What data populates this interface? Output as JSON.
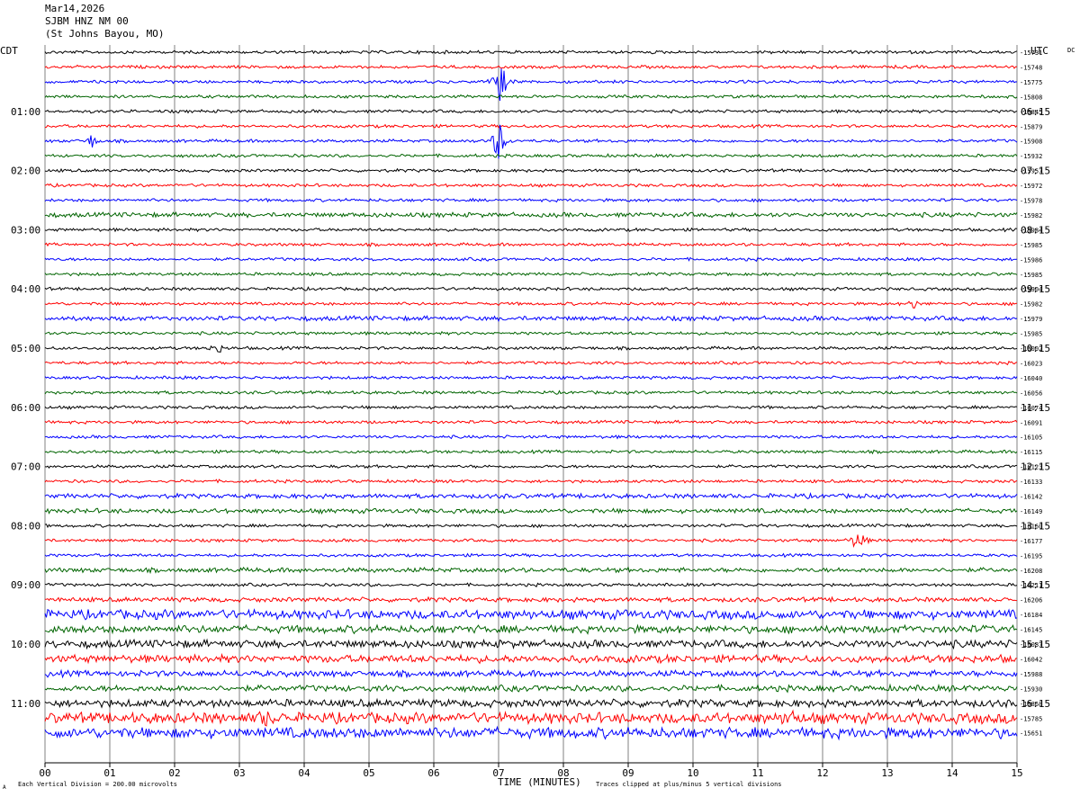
{
  "header": {
    "date": "Mar14,2026",
    "station": "SJBM HNZ NM 00",
    "location": "(St Johns Bayou, MO)"
  },
  "chart_data": {
    "type": "line",
    "title": "",
    "left_axis_label": "CDT",
    "right_axis_label": "UTC",
    "dc_label": "DC",
    "xlabel": "TIME (MINUTES)",
    "x_ticks": [
      "00",
      "01",
      "02",
      "03",
      "04",
      "05",
      "06",
      "07",
      "08",
      "09",
      "10",
      "11",
      "12",
      "13",
      "14",
      "15"
    ],
    "xlim": [
      0,
      15
    ],
    "left_hour_labels": [
      "01:00",
      "02:00",
      "03:00",
      "04:00",
      "05:00",
      "06:00",
      "07:00",
      "08:00",
      "09:00",
      "10:00",
      "11:00"
    ],
    "right_hour_labels": [
      "06:15",
      "07:15",
      "08:15",
      "09:15",
      "10:15",
      "11:15",
      "12:15",
      "13:15",
      "14:15",
      "15:15",
      "16:15"
    ],
    "trace_colors": [
      "#000000",
      "#ff0000",
      "#0000ff",
      "#006400"
    ],
    "dc_offsets": [
      "-15731",
      "-15748",
      "-15775",
      "-15808",
      "-15845",
      "-15879",
      "-15908",
      "-15932",
      "-15957",
      "-15972",
      "-15978",
      "-15982",
      "-15984",
      "-15985",
      "-15986",
      "-15985",
      "-15904",
      "-15982",
      "-15979",
      "-15985",
      "-16002",
      "-16023",
      "-16040",
      "-16056",
      "-16074",
      "-16091",
      "-16105",
      "-16115",
      "-16123",
      "-16133",
      "-16142",
      "-16149",
      "-16160",
      "-16177",
      "-16195",
      "-16208",
      "-16211",
      "-16206",
      "-16184",
      "-16145",
      "-16087",
      "-16042",
      "-15988",
      "-15930",
      "-15868",
      "-15785",
      "-15651"
    ],
    "noise_level": [
      2,
      2,
      2,
      2,
      2,
      2,
      2,
      2,
      2,
      2,
      2,
      3,
      2,
      2,
      2,
      2,
      2,
      2,
      3,
      2,
      2,
      2,
      2,
      2,
      2,
      2,
      2,
      2,
      2,
      2,
      3,
      3,
      2,
      2,
      2,
      3,
      2,
      3,
      6,
      5,
      5,
      5,
      4,
      4,
      5,
      7,
      7
    ],
    "events": [
      {
        "trace": 2,
        "minute": 7.03,
        "amplitude": 30
      },
      {
        "trace": 6,
        "minute": 7.0,
        "amplitude": 30
      },
      {
        "trace": 6,
        "minute": 0.72,
        "amplitude": 8
      },
      {
        "trace": 17,
        "minute": 13.4,
        "amplitude": 6
      },
      {
        "trace": 20,
        "minute": 2.65,
        "amplitude": 8
      },
      {
        "trace": 33,
        "minute": 12.55,
        "amplitude": 18
      },
      {
        "trace": 45,
        "minute": 3.4,
        "amplitude": 8
      },
      {
        "trace": 45,
        "minute": 11.5,
        "amplitude": 10
      }
    ],
    "footer_left": "Each Vertical Division =  200.00 microvolts",
    "footer_right": "Traces clipped at plus/minus 5 vertical divisions",
    "corner_mark": "A"
  }
}
